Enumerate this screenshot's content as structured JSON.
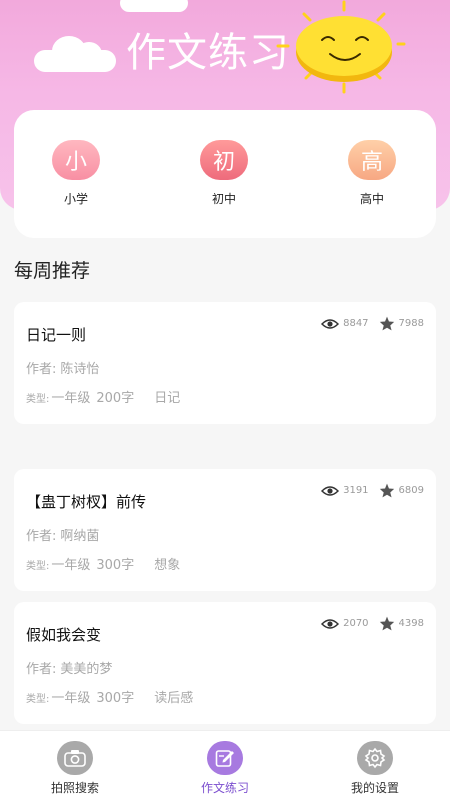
{
  "header": {
    "title": "作文练习",
    "colors": {
      "gradient_top": "#f2a9dc",
      "gradient_bottom": "#f7c2ea",
      "sun": "#ffe033"
    }
  },
  "levels": [
    {
      "char": "小",
      "label": "小学"
    },
    {
      "char": "初",
      "label": "初中"
    },
    {
      "char": "高",
      "label": "高中"
    }
  ],
  "section": {
    "title": "每周推荐"
  },
  "labels": {
    "author_prefix": "作者:",
    "type_prefix": "类型:"
  },
  "articles": [
    {
      "title": "日记一则",
      "author": "陈诗怡",
      "views": "8847",
      "favorites": "7988",
      "grade": "一年级",
      "words": "200字",
      "category": "日记"
    },
    {
      "title": "【蛊丁树杈】前传",
      "author": "啊纳菌",
      "views": "3191",
      "favorites": "6809",
      "grade": "一年级",
      "words": "300字",
      "category": "想象"
    },
    {
      "title": "假如我会变",
      "author": "美美的梦",
      "views": "2070",
      "favorites": "4398",
      "grade": "一年级",
      "words": "300字",
      "category": "读后感"
    }
  ],
  "nav": [
    {
      "label": "拍照搜索",
      "icon": "camera-icon",
      "active": false
    },
    {
      "label": "作文练习",
      "icon": "edit-icon",
      "active": true
    },
    {
      "label": "我的设置",
      "icon": "gear-icon",
      "active": false
    }
  ],
  "colors": {
    "accent": "#7c4fcf",
    "nav_inactive_icon": "#a9a9a9",
    "nav_active_icon": "#a77ae0"
  }
}
